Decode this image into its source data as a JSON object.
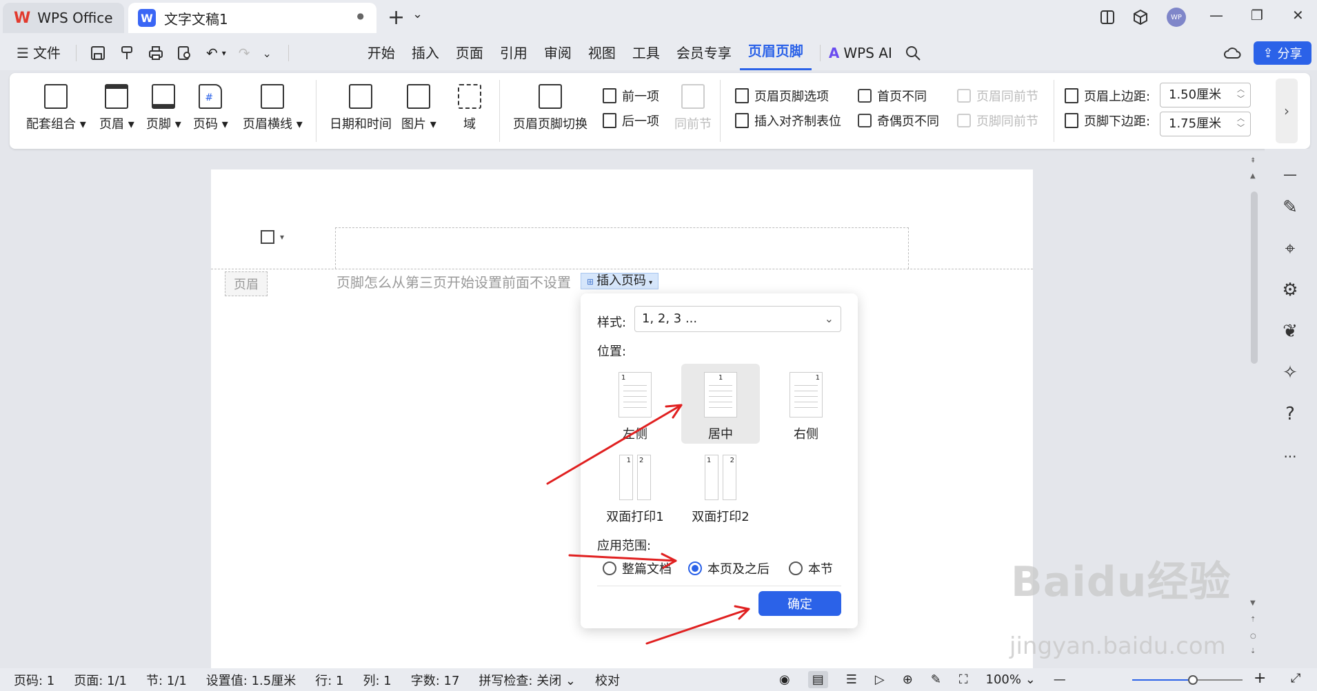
{
  "tabs": {
    "wps": "WPS Office",
    "doc": "文字文稿1",
    "doc_dot": "●",
    "add": "+",
    "chevron": "⌄"
  },
  "window": {
    "avatar": "WP",
    "min": "—",
    "max": "❐",
    "close": "✕"
  },
  "menu": {
    "file": "文件",
    "items": [
      "开始",
      "插入",
      "页面",
      "引用",
      "审阅",
      "视图",
      "工具",
      "会员专享",
      "页眉页脚"
    ],
    "wps_ai": "WPS AI",
    "share": "分享"
  },
  "ribbon": {
    "combo": "配套组合",
    "header": "页眉",
    "footer": "页脚",
    "pagenum": "页码",
    "header_line": "页眉横线",
    "datetime": "日期和时间",
    "picture": "图片",
    "field": "域",
    "switch": "页眉页脚切换",
    "prev": "前一项",
    "next": "后一项",
    "same_prev": "同前节",
    "hf_options": "页眉页脚选项",
    "insert_tab": "插入对齐制表位",
    "first_diff": "首页不同",
    "oddeven_diff": "奇偶页不同",
    "header_same": "页眉同前节",
    "footer_same": "页脚同前节",
    "top_margin_label": "页眉上边距:",
    "top_margin_value": "1.50厘米",
    "bottom_margin_label": "页脚下边距:",
    "bottom_margin_value": "1.75厘米"
  },
  "doc": {
    "header_label": "页眉",
    "header_text": "页脚怎么从第三页开始设置前面不设置",
    "insert_page_num": "插入页码"
  },
  "dialog": {
    "style_label": "样式:",
    "style_value": "1, 2, 3 ...",
    "position_label": "位置:",
    "positions": [
      "左侧",
      "居中",
      "右侧",
      "双面打印1",
      "双面打印2"
    ],
    "scope_label": "应用范围:",
    "scopes": [
      "整篇文档",
      "本页及之后",
      "本节"
    ],
    "selected_scope": "本页及之后",
    "ok": "确定"
  },
  "status": {
    "pagecode": "页码: 1",
    "page": "页面: 1/1",
    "section": "节: 1/1",
    "setting": "设置值: 1.5厘米",
    "row": "行: 1",
    "col": "列: 1",
    "words": "字数: 17",
    "spell": "拼写检查: 关闭",
    "proof": "校对",
    "zoom": "100%",
    "zoom_level": 0.55
  },
  "watermark": {
    "brand": "Baidu经验",
    "url": "jingyan.baidu.com"
  },
  "colors": {
    "accent": "#2b62e8",
    "arrow": "#e02020",
    "wps_red": "#e23a2e"
  }
}
